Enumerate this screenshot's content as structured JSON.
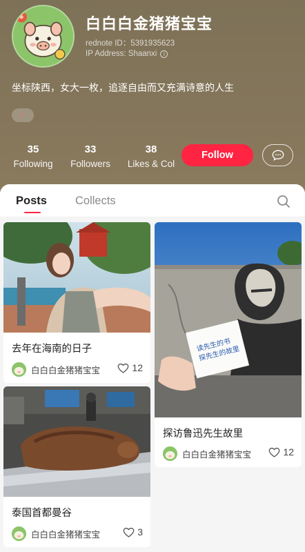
{
  "profile": {
    "nickname": "白白白金猪猪宝宝",
    "rednote_id": "rednote ID：5391935623",
    "ip_address": "IP Address: Shaanxi",
    "bio": "坐标陕西，女大一枚，追逐自由而又充满诗意的人生",
    "gender_symbol": "♀"
  },
  "stats": {
    "following": {
      "count": "35",
      "label": "Following"
    },
    "followers": {
      "count": "33",
      "label": "Followers"
    },
    "likes": {
      "count": "38",
      "label": "Likes & Col"
    }
  },
  "actions": {
    "follow_label": "Follow",
    "message_icon": "chat-bubble-icon"
  },
  "tabs": [
    {
      "label": "Posts",
      "active": true
    },
    {
      "label": "Collects",
      "active": false
    }
  ],
  "notes": [
    {
      "title": "去年在海南的日子",
      "author": "白白白金猪猪宝宝",
      "likes": "12"
    },
    {
      "title": "泰国首都曼谷",
      "author": "白白白金猪猪宝宝",
      "likes": "3"
    },
    {
      "title": "探访鲁迅先生故里",
      "author": "白白白金猪猪宝宝",
      "likes": "12"
    }
  ],
  "note_image_text": {
    "line1": "读先生的书",
    "line2": "探先生的故里"
  },
  "colors": {
    "accent": "#ff2442",
    "header_bg": "#83755a"
  }
}
